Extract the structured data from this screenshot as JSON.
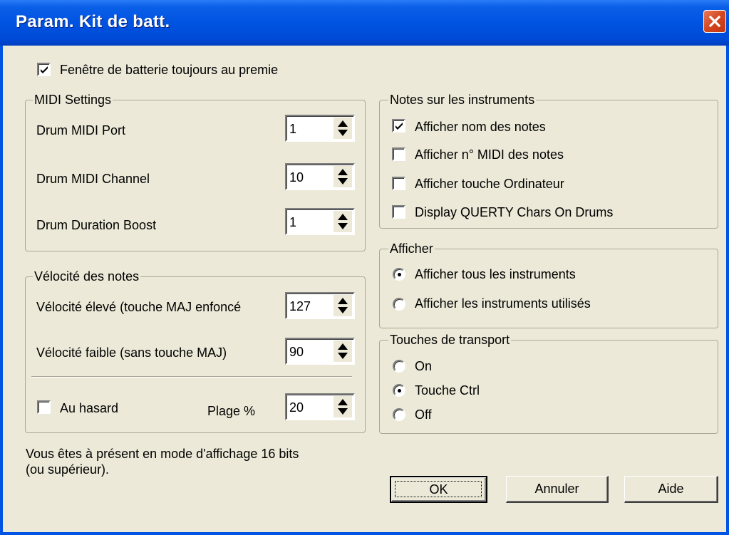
{
  "window": {
    "title": "Param. Kit de batt."
  },
  "top_option": {
    "label": "Fenêtre de batterie toujours au premie",
    "checked": true
  },
  "midi_settings": {
    "group_label": "MIDI Settings",
    "port": {
      "label": "Drum MIDI Port",
      "value": "1"
    },
    "channel": {
      "label": "Drum MIDI Channel",
      "value": "10"
    },
    "boost": {
      "label": "Drum Duration Boost",
      "value": "1"
    }
  },
  "velocity": {
    "group_label": "Vélocité des notes",
    "high": {
      "label": "Vélocité élevé (touche MAJ enfoncé",
      "value": "127"
    },
    "low": {
      "label": "Vélocité faible (sans touche MAJ)",
      "value": "90"
    },
    "random": {
      "label": "Au hasard",
      "checked": false
    },
    "range": {
      "label": "Plage %",
      "value": "20"
    }
  },
  "notes_instruments": {
    "group_label": "Notes sur les instruments",
    "items": [
      {
        "label": "Afficher nom des notes",
        "checked": true
      },
      {
        "label": "Afficher n° MIDI des notes",
        "checked": false
      },
      {
        "label": "Afficher touche Ordinateur",
        "checked": false
      },
      {
        "label": "Display QUERTY Chars On Drums",
        "checked": false
      }
    ]
  },
  "display": {
    "group_label": "Afficher",
    "options": [
      {
        "label": "Afficher tous les instruments",
        "selected": true
      },
      {
        "label": "Afficher les instruments utilisés",
        "selected": false
      }
    ]
  },
  "transport": {
    "group_label": "Touches de transport",
    "options": [
      {
        "label": "On",
        "selected": false
      },
      {
        "label": "Touche Ctrl",
        "selected": true
      },
      {
        "label": "Off",
        "selected": false
      }
    ]
  },
  "status_text": {
    "line1": "Vous êtes à présent en mode d'affichage 16 bits",
    "line2": "(ou supérieur)."
  },
  "buttons": {
    "ok": "OK",
    "cancel": "Annuler",
    "help": "Aide"
  }
}
